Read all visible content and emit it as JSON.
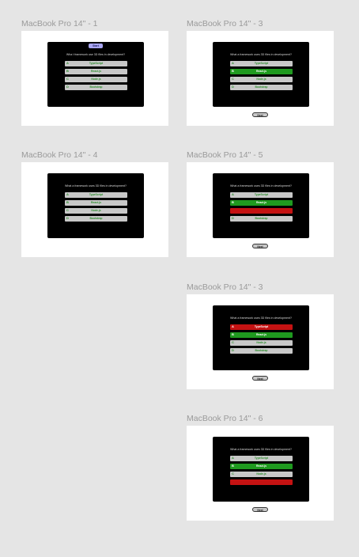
{
  "frames": [
    {
      "label": "MacBook Pro 14\" - 1",
      "start": "Start",
      "question": "Wha t framework use 3D files in development?",
      "answers": [
        {
          "letter": "A",
          "text": "TypeScript",
          "state": "default"
        },
        {
          "letter": "B",
          "text": "React.js",
          "state": "default"
        },
        {
          "letter": "C",
          "text": "Node.js",
          "state": "default"
        },
        {
          "letter": "D",
          "text": "Bootstrap",
          "state": "default"
        }
      ]
    },
    {
      "label": "MacBook Pro 14\" - 3",
      "question": "What a framework uses 3D files in development?",
      "answers": [
        {
          "letter": "A",
          "text": "TypeScript",
          "state": "default"
        },
        {
          "letter": "B",
          "text": "React.js",
          "state": "correct"
        },
        {
          "letter": "C",
          "text": "Node.js",
          "state": "default"
        },
        {
          "letter": "D",
          "text": "Bootstrap",
          "state": "default"
        }
      ],
      "next": "Next"
    },
    {
      "label": "MacBook Pro 14\" - 4",
      "question": "What a framework uses 3D files in development?",
      "answers": [
        {
          "letter": "A",
          "text": "TypeScript",
          "state": "default"
        },
        {
          "letter": "B",
          "text": "React.js",
          "state": "default"
        },
        {
          "letter": "C",
          "text": "Node.js",
          "state": "default"
        },
        {
          "letter": "D",
          "text": "Bootstrap",
          "state": "default"
        }
      ]
    },
    {
      "label": "MacBook Pro 14\" - 5",
      "question": "What a framework uses 3D files in development?",
      "answers": [
        {
          "letter": "A",
          "text": "TypeScript",
          "state": "default"
        },
        {
          "letter": "B",
          "text": "React.js",
          "state": "correct"
        },
        {
          "letter": "",
          "text": "",
          "state": "wrong"
        },
        {
          "letter": "D",
          "text": "Bootstrap",
          "state": "default"
        }
      ],
      "next": "Next"
    },
    {
      "label": "MacBook Pro 14\" - 3",
      "question": "What a framework uses 3D files in development?",
      "answers": [
        {
          "letter": "A",
          "text": "TypeScript",
          "state": "wrong"
        },
        {
          "letter": "B",
          "text": "React.js",
          "state": "correct"
        },
        {
          "letter": "C",
          "text": "Node.js",
          "state": "default"
        },
        {
          "letter": "D",
          "text": "Bootstrap",
          "state": "default"
        }
      ],
      "next": "Next"
    },
    {
      "label": "MacBook Pro 14\" - 6",
      "question": "What a framework uses 3D files in development?",
      "answers": [
        {
          "letter": "A",
          "text": "TypeScript",
          "state": "default"
        },
        {
          "letter": "B",
          "text": "React.js",
          "state": "correct"
        },
        {
          "letter": "C",
          "text": "Node.js",
          "state": "default"
        },
        {
          "letter": "",
          "text": "",
          "state": "wrong"
        }
      ],
      "next": "Next"
    }
  ]
}
